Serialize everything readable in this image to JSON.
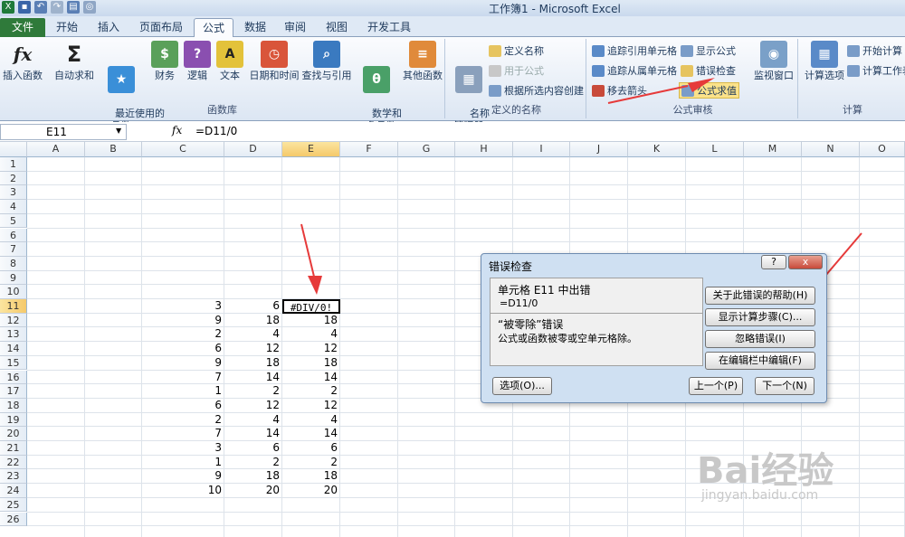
{
  "window": {
    "title": "工作簿1 - Microsoft Excel"
  },
  "tabs": [
    "文件",
    "开始",
    "插入",
    "页面布局",
    "公式",
    "数据",
    "审阅",
    "视图",
    "开发工具"
  ],
  "ribbon": {
    "insert_function": "插入函数",
    "autosum": "自动求和",
    "recent": "最近使用的\n函数",
    "financial": "财务",
    "logical": "逻辑",
    "text": "文本",
    "datetime": "日期和时间",
    "lookup": "查找与引用",
    "math": "数学和\n三角函数",
    "other": "其他函数",
    "group_library": "函数库",
    "name_manager": "名称\n管理器",
    "define_name": "定义名称",
    "use_in_formula": "用于公式",
    "create_from_selection": "根据所选内容创建",
    "group_names": "定义的名称",
    "trace_precedents": "追踪引用单元格",
    "trace_dependents": "追踪从属单元格",
    "remove_arrows": "移去箭头",
    "show_formulas": "显示公式",
    "error_checking": "错误检查",
    "evaluate_formula": "公式求值",
    "watch_window": "监视窗口",
    "group_auditing": "公式审核",
    "calc_options": "计算选项",
    "calc_now": "开始计算",
    "calc_sheet": "计算工作表",
    "group_calc": "计算"
  },
  "formula_bar": {
    "name_box": "E11",
    "fx": "fx",
    "formula": "=D11/0"
  },
  "columns": [
    "A",
    "B",
    "C",
    "D",
    "E",
    "F",
    "G",
    "H",
    "I",
    "J",
    "K",
    "L",
    "M",
    "N",
    "O"
  ],
  "rows": [
    "1",
    "2",
    "3",
    "4",
    "5",
    "6",
    "7",
    "8",
    "9",
    "10",
    "11",
    "12",
    "13",
    "14",
    "15",
    "16",
    "17",
    "18",
    "19",
    "20",
    "21",
    "22",
    "23",
    "24",
    "25",
    "26"
  ],
  "data_rows": [
    {
      "row": "11",
      "c": "3",
      "d": "6",
      "e": "#DIV/0!"
    },
    {
      "row": "12",
      "c": "9",
      "d": "18",
      "e": "18"
    },
    {
      "row": "13",
      "c": "2",
      "d": "4",
      "e": "4"
    },
    {
      "row": "14",
      "c": "6",
      "d": "12",
      "e": "12"
    },
    {
      "row": "15",
      "c": "9",
      "d": "18",
      "e": "18"
    },
    {
      "row": "16",
      "c": "7",
      "d": "14",
      "e": "14"
    },
    {
      "row": "17",
      "c": "1",
      "d": "2",
      "e": "2"
    },
    {
      "row": "18",
      "c": "6",
      "d": "12",
      "e": "12"
    },
    {
      "row": "19",
      "c": "2",
      "d": "4",
      "e": "4"
    },
    {
      "row": "20",
      "c": "7",
      "d": "14",
      "e": "14"
    },
    {
      "row": "21",
      "c": "3",
      "d": "6",
      "e": "6"
    },
    {
      "row": "22",
      "c": "1",
      "d": "2",
      "e": "2"
    },
    {
      "row": "23",
      "c": "9",
      "d": "18",
      "e": "18"
    },
    {
      "row": "24",
      "c": "10",
      "d": "20",
      "e": "20"
    }
  ],
  "dialog": {
    "title": "错误检查",
    "help_icon": "?",
    "close_icon": "x",
    "cell_error": "单元格 E11 中出错",
    "formula": "=D11/0",
    "error_type": "“被零除”错误",
    "error_desc": "公式或函数被零或空单元格除。",
    "help_btn": "关于此错误的帮助(H)",
    "show_steps_btn": "显示计算步骤(C)...",
    "ignore_btn": "忽略错误(I)",
    "edit_btn": "在编辑栏中编辑(F)",
    "options_btn": "选项(O)...",
    "prev_btn": "上一个(P)",
    "next_btn": "下一个(N)"
  },
  "watermark": {
    "text": "Bai经验",
    "url": "jingyan.baidu.com"
  }
}
